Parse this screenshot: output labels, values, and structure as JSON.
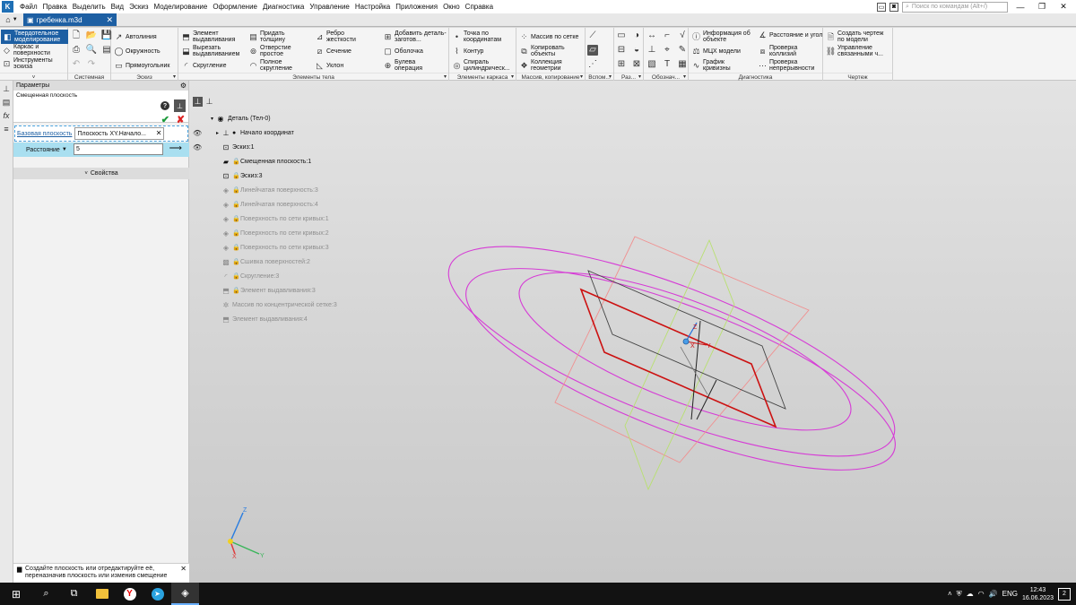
{
  "window": {
    "tab_title": "гребенка.m3d",
    "search_placeholder": "Поиск по командам (Alt+/)"
  },
  "menu": [
    "Файл",
    "Правка",
    "Выделить",
    "Вид",
    "Эскиз",
    "Моделирование",
    "Оформление",
    "Диагностика",
    "Управление",
    "Настройка",
    "Приложения",
    "Окно",
    "Справка"
  ],
  "ribbon": {
    "modes": [
      "Твердотельное моделирование",
      "Каркас и поверхности",
      "Инструменты эскиза"
    ],
    "groups": {
      "system": "Системная",
      "sketch": "Эскиз",
      "body": "Элементы тела",
      "frame": "Элементы каркаса",
      "arrays": "Массив, копирование",
      "aux": "Вспом...",
      "sections": "Раз...",
      "notation": "Обознач...",
      "diagnostics": "Диагностика",
      "drawing": "Чертеж"
    },
    "sketch": {
      "autoline": "Автолиния",
      "circle": "Окружность",
      "rectangle": "Прямоугольник"
    },
    "body": {
      "extrude": "Элемент выдавливания",
      "cut_extrude": "Вырезать выдавливанием",
      "fillet": "Скругление",
      "thicken": "Придать толщину",
      "hole": "Отверстие простое",
      "full_fillet": "Полное скругление",
      "rib": "Ребро жесткости",
      "section": "Сечение",
      "draft": "Уклон",
      "add_part": "Добавить деталь-заготов...",
      "shell": "Оболочка",
      "boolean": "Булева операция"
    },
    "frame": {
      "point_coords": "Точка по координатам",
      "contour": "Контур",
      "spiral": "Спираль цилиндрическ..."
    },
    "arrays": {
      "grid_array": "Массив по сетке",
      "copy_objects": "Копировать объекты",
      "geometry_collection": "Коллекция геометрии"
    },
    "diagnostics": {
      "object_info": "Информация об объекте",
      "mcs_model": "МЦХ модели",
      "curvature": "График кривизны",
      "distance_angle": "Расстояние и угол",
      "check_collisions": "Проверка коллизий",
      "check_continuity": "Проверка непрерывности"
    },
    "drawing": {
      "create_drawing": "Создать чертеж по модели",
      "manage_linked": "Управление связанными ч..."
    }
  },
  "params": {
    "title": "Параметры",
    "operation": "Смещенная плоскость",
    "base_plane_label": "Базовая плоскость",
    "base_plane_value": "Плоскость XY.Начало...",
    "distance_label": "Расстояние",
    "distance_value": "5",
    "properties_label": "Свойства",
    "hint": "Создайте плоскость или отредактируйте её, переназначив плоскость или изменив смещение"
  },
  "tree": {
    "root": "Деталь (Тел-0)",
    "items": [
      {
        "label": "Начало координат",
        "disabled": false
      },
      {
        "label": "Эскиз:1",
        "disabled": false
      },
      {
        "label": "Смещенная плоскость:1",
        "disabled": false
      },
      {
        "label": "Эскиз:3",
        "disabled": false
      },
      {
        "label": "Линейчатая поверхность:3",
        "disabled": true
      },
      {
        "label": "Линейчатая поверхность:4",
        "disabled": true
      },
      {
        "label": "Поверхность по сети кривых:1",
        "disabled": true
      },
      {
        "label": "Поверхность по сети кривых:2",
        "disabled": true
      },
      {
        "label": "Поверхность по сети кривых:3",
        "disabled": true
      },
      {
        "label": "Сшивка поверхностей:2",
        "disabled": true
      },
      {
        "label": "Скругление:3",
        "disabled": true
      },
      {
        "label": "Элемент выдавливания:3",
        "disabled": true
      },
      {
        "label": "Массив по концентрической сетке:3",
        "disabled": true
      },
      {
        "label": "Элемент выдавливания:4",
        "disabled": true
      }
    ]
  },
  "triad": {
    "x": "X",
    "y": "Y",
    "z": "Z"
  },
  "colors": {
    "accent": "#1d5fa3",
    "active_row": "#a9dff0",
    "ok": "#1b9a3a",
    "cancel": "#dd2222",
    "ellipse": "#d63bd6",
    "selected_plane": "#cc1111"
  },
  "taskbar": {
    "language": "ENG",
    "time": "12:43",
    "date": "16.06.2023",
    "notifications": "2"
  }
}
